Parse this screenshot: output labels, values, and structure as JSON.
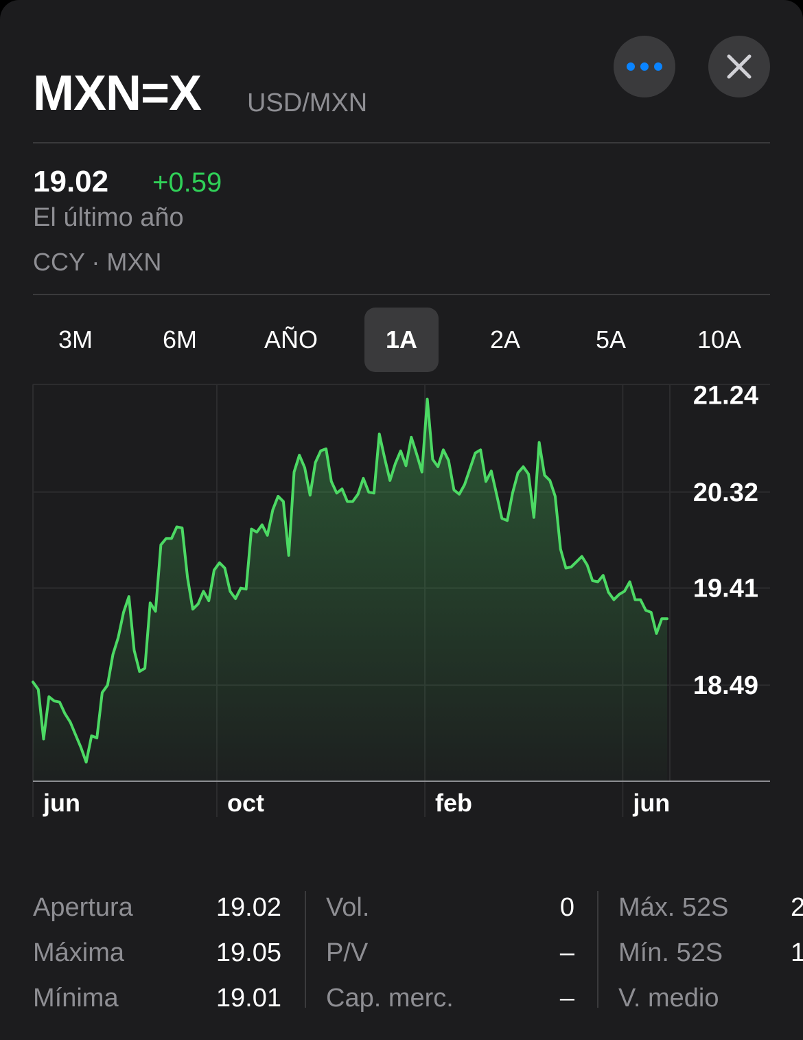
{
  "header": {
    "symbol": "MXN=X",
    "pair": "USD/MXN",
    "more_icon": "ellipsis-icon",
    "close_icon": "close-icon",
    "accent": "#0a84ff"
  },
  "quote": {
    "price": "19.02",
    "change": "+0.59",
    "period": "El último año",
    "exchange": "CCY · MXN",
    "change_color": "#30d158"
  },
  "tabs": [
    {
      "label": "3M"
    },
    {
      "label": "6M"
    },
    {
      "label": "AÑO"
    },
    {
      "label": "1A",
      "active": true
    },
    {
      "label": "2A"
    },
    {
      "label": "5A"
    },
    {
      "label": "10A"
    }
  ],
  "chart_data": {
    "type": "area",
    "title": "",
    "ylim": [
      17.58,
      21.34
    ],
    "y_ticks": [
      "21.24",
      "20.32",
      "19.41",
      "18.49"
    ],
    "x_ticks": [
      "jun",
      "oct",
      "feb",
      "jun"
    ],
    "line_color": "#4cd964",
    "values": [
      18.52,
      18.45,
      17.98,
      18.38,
      18.34,
      18.33,
      18.22,
      18.14,
      18.02,
      17.9,
      17.76,
      18.01,
      17.99,
      18.42,
      18.49,
      18.78,
      18.94,
      19.18,
      19.33,
      18.82,
      18.62,
      18.65,
      19.27,
      19.19,
      19.82,
      19.88,
      19.88,
      19.99,
      19.98,
      19.51,
      19.21,
      19.26,
      19.38,
      19.29,
      19.58,
      19.65,
      19.6,
      19.38,
      19.31,
      19.41,
      19.4,
      19.97,
      19.94,
      20.01,
      19.91,
      20.15,
      20.28,
      20.23,
      19.72,
      20.51,
      20.67,
      20.55,
      20.29,
      20.6,
      20.71,
      20.73,
      20.42,
      20.31,
      20.35,
      20.23,
      20.23,
      20.3,
      20.45,
      20.32,
      20.31,
      20.87,
      20.64,
      20.43,
      20.59,
      20.71,
      20.57,
      20.84,
      20.68,
      20.51,
      21.2,
      20.63,
      20.56,
      20.72,
      20.62,
      20.34,
      20.3,
      20.39,
      20.54,
      20.69,
      20.72,
      20.42,
      20.52,
      20.3,
      20.07,
      20.05,
      20.31,
      20.5,
      20.56,
      20.49,
      20.08,
      20.79,
      20.48,
      20.43,
      20.28,
      19.78,
      19.6,
      19.61,
      19.66,
      19.71,
      19.63,
      19.48,
      19.47,
      19.53,
      19.37,
      19.3,
      19.35,
      19.38,
      19.47,
      19.3,
      19.3,
      19.2,
      19.18,
      18.98,
      19.12,
      19.12
    ]
  },
  "stats": {
    "col1": [
      {
        "label": "Apertura",
        "value": "19.02"
      },
      {
        "label": "Máxima",
        "value": "19.05"
      },
      {
        "label": "Mínima",
        "value": "19.01"
      }
    ],
    "col2": [
      {
        "label": "Vol.",
        "value": "0"
      },
      {
        "label": "P/V",
        "value": "–"
      },
      {
        "label": "Cap. merc.",
        "value": "–"
      }
    ],
    "col3": [
      {
        "label": "Máx. 52S",
        "value": "2"
      },
      {
        "label": "Mín. 52S",
        "value": "1"
      },
      {
        "label": "V. medio",
        "value": ""
      }
    ]
  }
}
